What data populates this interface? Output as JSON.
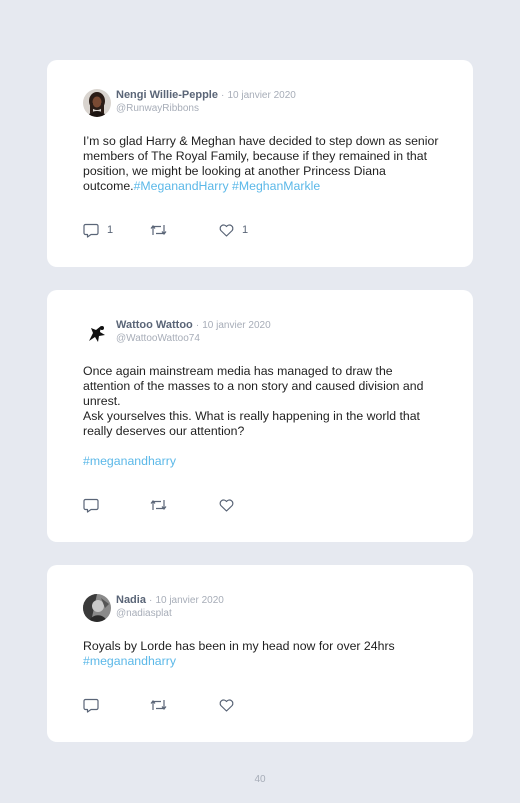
{
  "tweets": [
    {
      "name": "Nengi Willie-Pepple",
      "separator": "·",
      "date": "10 janvier 2020",
      "handle": "@RunwayRibbons",
      "text": "I’m so glad Harry & Meghan have decided to step down as senior members of The Royal Family, because if they remained in that position, we might be looking at another Princess Diana outcome.",
      "hashtags": "#MeganandHarry #MeghanMarkle",
      "reply_count": "1",
      "like_count": "1"
    },
    {
      "name": "Wattoo Wattoo",
      "separator": "·",
      "date": "10 janvier 2020",
      "handle": "@WattooWattoo74",
      "text": "Once again mainstream media has managed to draw the attention of the masses to a non story and caused division and unrest.\nAsk yourselves this. What is really happening in the world that really deserves our attention?",
      "hashtags": "#meganandharry"
    },
    {
      "name": "Nadia",
      "separator": "·",
      "date": "10 janvier 2020",
      "handle": "@nadiasplat",
      "text": "Royals by Lorde has been in my head now for over 24hrs",
      "hashtags": "#meganandharry"
    }
  ],
  "icons": {
    "reply": "reply-icon",
    "retweet": "retweet-icon",
    "like": "heart-icon"
  },
  "colors": {
    "background": "#e6e9f0",
    "card": "#ffffff",
    "name": "#5a6577",
    "meta": "#a7adb8",
    "hashtag": "#5bb8e8"
  },
  "page_number": "40"
}
